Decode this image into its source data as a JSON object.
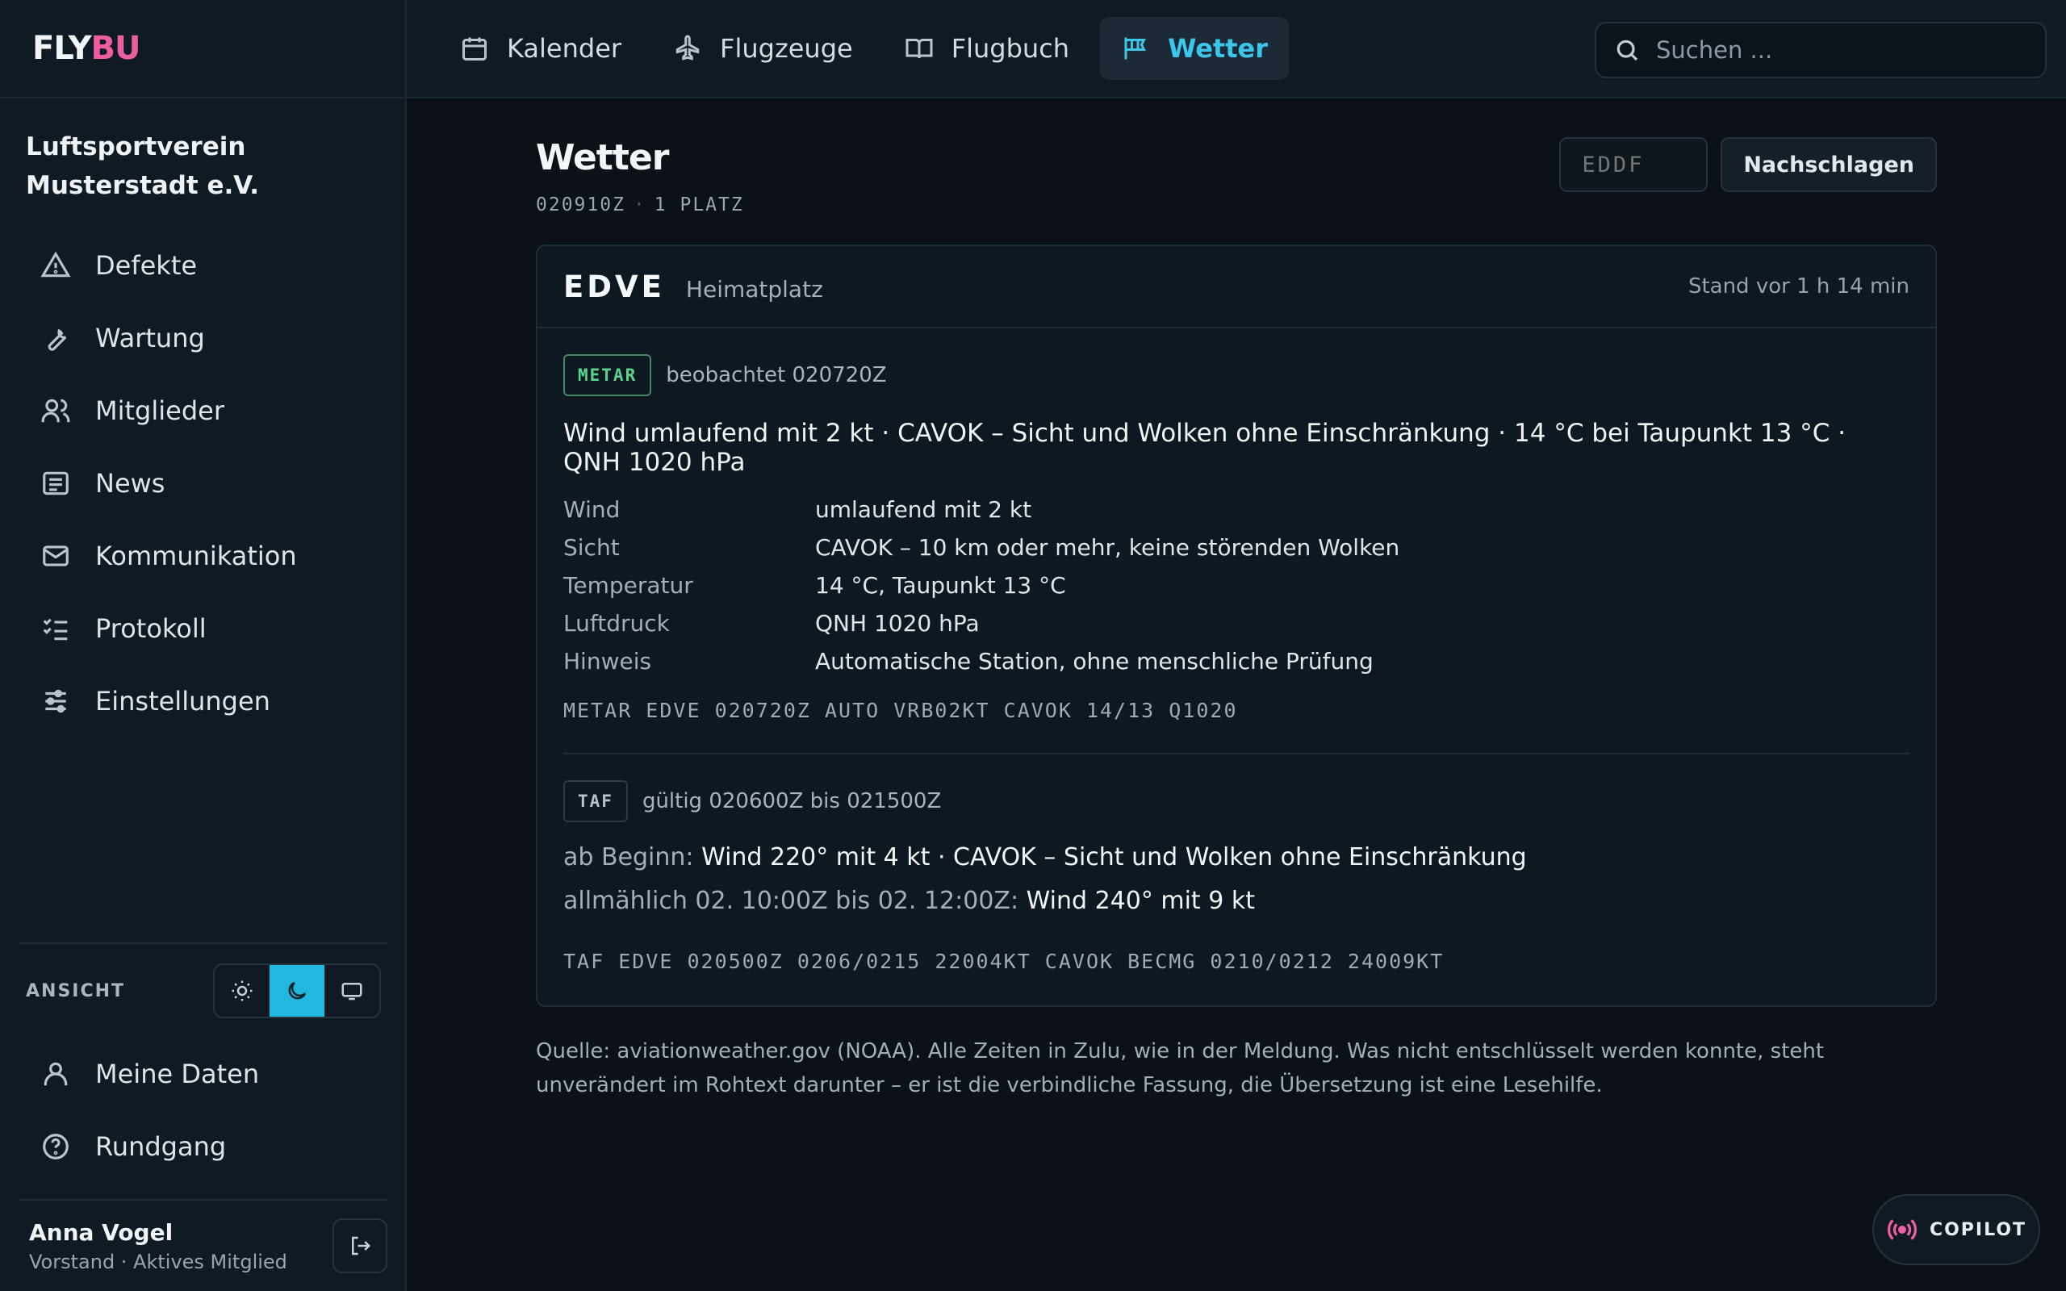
{
  "brand": {
    "part1": "FLY",
    "part2": "BU"
  },
  "org_name": "Luftsportverein Musterstadt e.V.",
  "sidebar": {
    "items": [
      {
        "label": "Defekte",
        "icon": "warning-icon"
      },
      {
        "label": "Wartung",
        "icon": "wrench-icon"
      },
      {
        "label": "Mitglieder",
        "icon": "users-icon"
      },
      {
        "label": "News",
        "icon": "news-icon"
      },
      {
        "label": "Kommunikation",
        "icon": "mail-icon"
      },
      {
        "label": "Protokoll",
        "icon": "checklist-icon"
      },
      {
        "label": "Einstellungen",
        "icon": "sliders-icon"
      }
    ],
    "view_label": "ANSICHT",
    "view_modes": [
      "light",
      "dark",
      "system"
    ],
    "view_active": "dark",
    "bottom_items": [
      {
        "label": "Meine Daten",
        "icon": "user-icon"
      },
      {
        "label": "Rundgang",
        "icon": "help-icon"
      }
    ],
    "user": {
      "name": "Anna Vogel",
      "role": "Vorstand · Aktives Mitglied"
    }
  },
  "topbar": {
    "tabs": [
      {
        "label": "Kalender",
        "icon": "calendar-icon"
      },
      {
        "label": "Flugzeuge",
        "icon": "plane-icon"
      },
      {
        "label": "Flugbuch",
        "icon": "book-icon"
      },
      {
        "label": "Wetter",
        "icon": "windsock-icon",
        "active": true
      }
    ],
    "search_placeholder": "Suchen ..."
  },
  "page": {
    "title": "Wetter",
    "subtitle_time": "020910Z",
    "subtitle_count": "1 PLATZ",
    "icao_placeholder": "EDDF",
    "lookup_label": "Nachschlagen"
  },
  "station": {
    "icao": "EDVE",
    "name": "Heimatplatz",
    "stand": "Stand vor 1 h 14 min",
    "metar": {
      "badge": "METAR",
      "observed": "beobachtet 020720Z",
      "summary": "Wind umlaufend mit 2 kt · CAVOK – Sicht und Wolken ohne Einschränkung · 14 °C bei Taupunkt 13 °C · QNH 1020 hPa",
      "rows": [
        {
          "k": "Wind",
          "v": "umlaufend mit 2 kt"
        },
        {
          "k": "Sicht",
          "v": "CAVOK – 10 km oder mehr, keine störenden Wolken"
        },
        {
          "k": "Temperatur",
          "v": "14 °C, Taupunkt 13 °C"
        },
        {
          "k": "Luftdruck",
          "v": "QNH 1020 hPa"
        },
        {
          "k": "Hinweis",
          "v": "Automatische Station, ohne menschliche Prüfung"
        }
      ],
      "raw": "METAR EDVE 020720Z AUTO VRB02KT CAVOK 14/13 Q1020"
    },
    "taf": {
      "badge": "TAF",
      "valid": "gültig 020600Z bis 021500Z",
      "lines": [
        {
          "label": "ab Beginn:",
          "value": "Wind 220° mit 4 kt · CAVOK – Sicht und Wolken ohne Einschränkung"
        },
        {
          "label": "allmählich 02. 10:00Z bis 02. 12:00Z:",
          "value": "Wind 240° mit 9 kt"
        }
      ],
      "raw": "TAF EDVE 020500Z 0206/0215 22004KT CAVOK BECMG 0210/0212 24009KT"
    }
  },
  "source_note": "Quelle: aviationweather.gov (NOAA). Alle Zeiten in Zulu, wie in der Meldung. Was nicht entschlüsselt werden konnte, steht unverändert im Rohtext darunter – er ist die verbindliche Fassung, die Übersetzung ist eine Lesehilfe.",
  "copilot_label": "COPILOT",
  "colors": {
    "accent": "#22b8de",
    "brand_pink": "#ec5ea2",
    "metar_green": "#5bd28e"
  }
}
